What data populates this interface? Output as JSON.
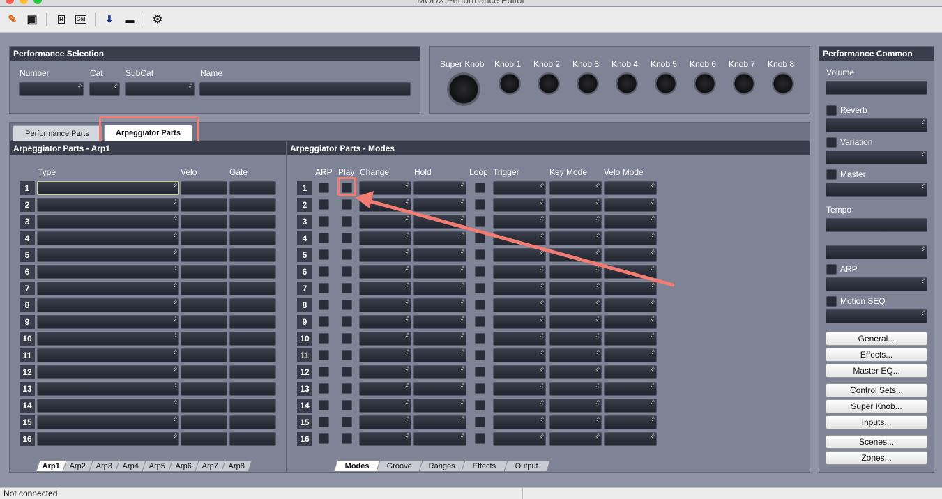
{
  "window": {
    "title": "MODX Performance Editor"
  },
  "colors": {
    "panel": "#7e8396",
    "header": "#3a3e4c",
    "highlight": "#f07c72"
  },
  "toolbar": {
    "buttons": [
      {
        "name": "open-icon",
        "glyph": "✎"
      },
      {
        "name": "save-icon",
        "glyph": "▣"
      },
      {
        "name": "r-button",
        "label": "R"
      },
      {
        "name": "gm-button",
        "label": "GM"
      },
      {
        "name": "download-icon",
        "glyph": "⬇"
      },
      {
        "name": "device-icon",
        "glyph": "▬"
      },
      {
        "name": "network-icon",
        "glyph": "⚙"
      }
    ]
  },
  "performance_selection": {
    "title": "Performance Selection",
    "labels": {
      "number": "Number",
      "cat": "Cat",
      "subcat": "SubCat",
      "name": "Name"
    },
    "values": {
      "number": "",
      "cat": "",
      "subcat": "",
      "name": ""
    }
  },
  "knobs": {
    "super_knob": "Super Knob",
    "labels": [
      "Knob 1",
      "Knob 2",
      "Knob 3",
      "Knob 4",
      "Knob 5",
      "Knob 6",
      "Knob 7",
      "Knob 8"
    ]
  },
  "main_tabs": [
    "Performance Parts",
    "Arpeggiator Parts"
  ],
  "active_main_tab": "Arpeggiator Parts",
  "arp_panel": {
    "title": "Arpeggiator Parts - Arp1",
    "columns": {
      "type": "Type",
      "velo": "Velo",
      "gate": "Gate"
    },
    "bottom_tabs": [
      "Arp1",
      "Arp2",
      "Arp3",
      "Arp4",
      "Arp5",
      "Arp6",
      "Arp7",
      "Arp8"
    ],
    "active_tab": "Arp1"
  },
  "modes_panel": {
    "title": "Arpeggiator Parts - Modes",
    "columns": {
      "arp": "ARP",
      "play": "Play",
      "change": "Change",
      "hold": "Hold",
      "loop": "Loop",
      "trigger": "Trigger",
      "key_mode": "Key Mode",
      "velo_mode": "Velo Mode"
    },
    "bottom_tabs": [
      "Modes",
      "Groove",
      "Ranges",
      "Effects",
      "Output"
    ],
    "active_tab": "Modes"
  },
  "parts": [
    "1",
    "2",
    "3",
    "4",
    "5",
    "6",
    "7",
    "8",
    "9",
    "10",
    "11",
    "12",
    "13",
    "14",
    "15",
    "16"
  ],
  "performance_common": {
    "title": "Performance Common",
    "volume": "Volume",
    "reverb": "Reverb",
    "variation": "Variation",
    "master": "Master",
    "tempo": "Tempo",
    "arp": "ARP",
    "motion_seq": "Motion SEQ",
    "buttons": [
      "General...",
      "Effects...",
      "Master EQ...",
      "Control Sets...",
      "Super Knob...",
      "Inputs...",
      "Scenes...",
      "Zones..."
    ]
  },
  "status": {
    "text": "Not connected"
  }
}
